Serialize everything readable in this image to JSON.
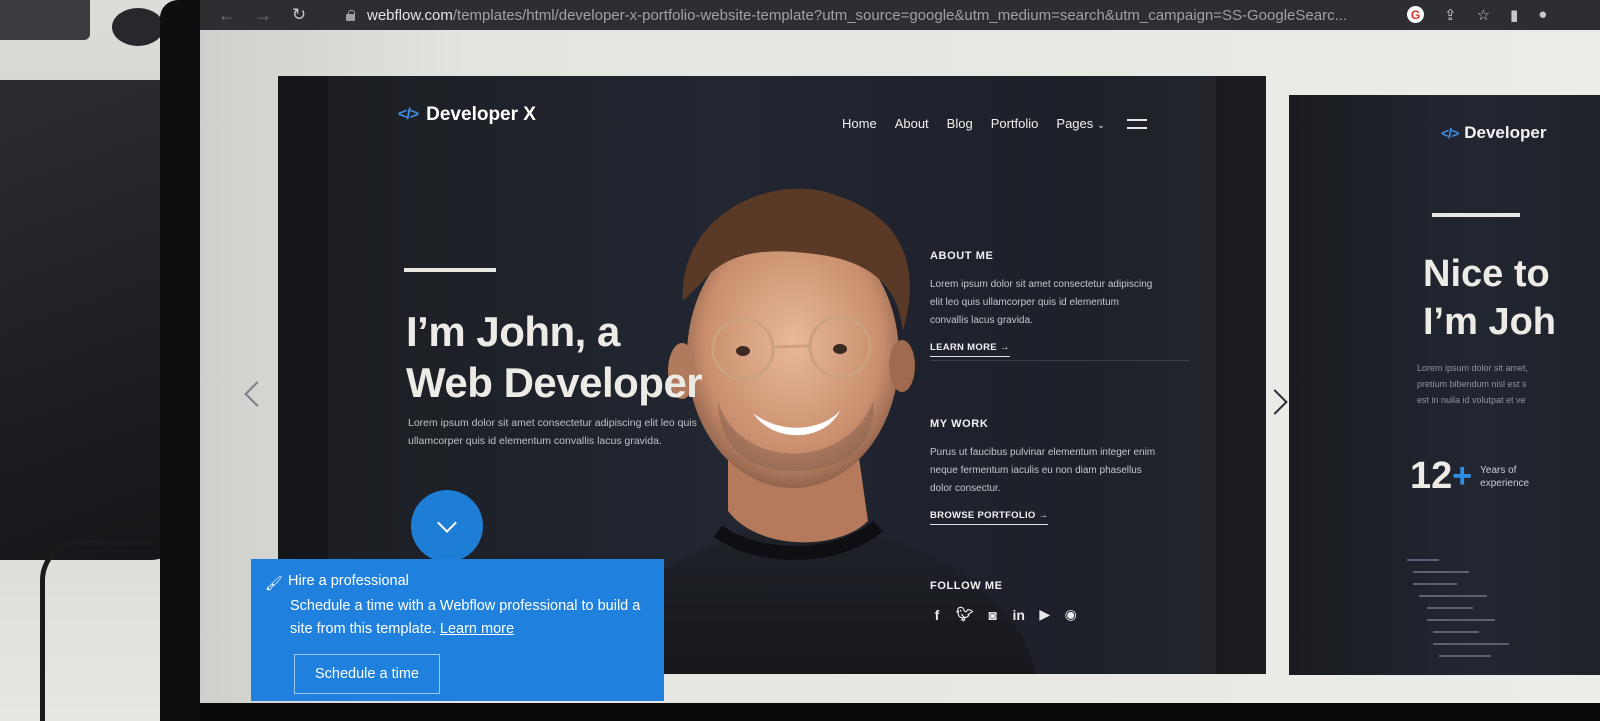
{
  "browser": {
    "url_host": "webflow.com",
    "url_path": "/templates/html/developer-x-portfolio-website-template?utm_source=google&utm_medium=search&utm_campaign=SS-GoogleSearc...",
    "back_icon": "arrow-left-icon",
    "forward_icon": "arrow-right-icon",
    "reload_icon": "reload-icon"
  },
  "site": {
    "logo_code": "</>",
    "logo_name": "Developer X",
    "nav": [
      "Home",
      "About",
      "Blog",
      "Portfolio",
      "Pages"
    ],
    "hero_title_line1": "I’m John, a",
    "hero_title_line2": "Web Developer",
    "hero_desc": "Lorem ipsum dolor sit amet consectetur adipiscing elit leo quis ullamcorper quis id elementum convallis lacus gravida.",
    "about_title": "ABOUT ME",
    "about_body": "Lorem ipsum dolor sit amet consectetur adipiscing elit leo quis ullamcorper quis id elementum convallis lacus gravida.",
    "about_link": "LEARN MORE →",
    "work_title": "MY WORK",
    "work_body": "Purus ut faucibus pulvinar elementum integer enim neque fermentum iaculis eu non diam phasellus dolor consectur.",
    "work_link": "BROWSE PORTFOLIO →",
    "follow_title": "FOLLOW ME",
    "social": [
      "f",
      "t",
      "ig",
      "in",
      "yt",
      "gh"
    ]
  },
  "slide2": {
    "logo_code": "</>",
    "logo_name": "Developer",
    "title_line1": "Nice to",
    "title_line2": "I’m Joh",
    "body_line1": "Lorem ipsum dolor sit amet,",
    "body_line2": "pretium bibendum nisl est s",
    "body_line3": "est in nulla id volutpat et ve",
    "stat_num": "12",
    "stat_plus": "+",
    "stat_label_line1": "Years of",
    "stat_label_line2": "experience"
  },
  "hire": {
    "title": "Hire a professional",
    "text": "Schedule a time with a Webflow professional to build a site from this template.",
    "link": "Learn more",
    "button": "Schedule a time"
  },
  "colors": {
    "accent_blue": "#1f80de",
    "slide_bg": "#1d2029",
    "logo_code": "#3f8fe0"
  }
}
